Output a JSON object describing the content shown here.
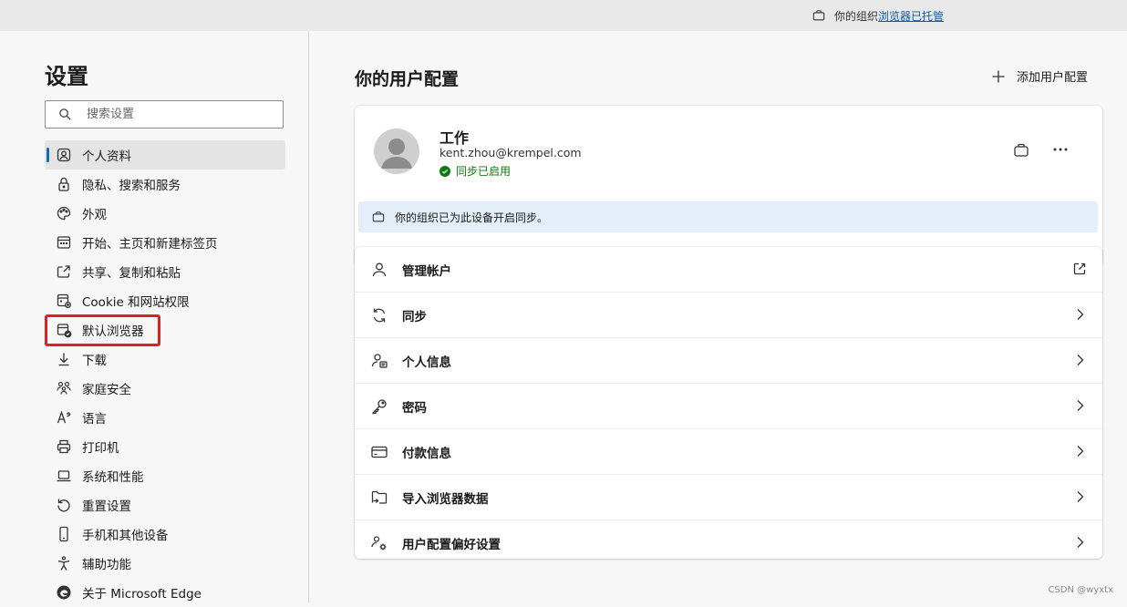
{
  "top_bar": {
    "managed_prefix": "你的组织",
    "managed_link": "浏览器已托管",
    "icon": "briefcase-icon"
  },
  "sidebar": {
    "title": "设置",
    "search_placeholder": "搜索设置",
    "items": [
      {
        "label": "个人资料",
        "icon": "profile-icon",
        "active": true
      },
      {
        "label": "隐私、搜索和服务",
        "icon": "lock-icon"
      },
      {
        "label": "外观",
        "icon": "palette-icon"
      },
      {
        "label": "开始、主页和新建标签页",
        "icon": "home-grid-icon"
      },
      {
        "label": "共享、复制和粘贴",
        "icon": "share-icon"
      },
      {
        "label": "Cookie 和网站权限",
        "icon": "site-permissions-icon"
      },
      {
        "label": "默认浏览器",
        "icon": "default-browser-icon",
        "highlighted": true
      },
      {
        "label": "下载",
        "icon": "download-icon"
      },
      {
        "label": "家庭安全",
        "icon": "family-icon"
      },
      {
        "label": "语言",
        "icon": "language-icon"
      },
      {
        "label": "打印机",
        "icon": "printer-icon"
      },
      {
        "label": "系统和性能",
        "icon": "laptop-icon"
      },
      {
        "label": "重置设置",
        "icon": "reset-icon"
      },
      {
        "label": "手机和其他设备",
        "icon": "phone-icon"
      },
      {
        "label": "辅助功能",
        "icon": "accessibility-icon"
      },
      {
        "label": "关于 Microsoft Edge",
        "icon": "edge-logo-icon"
      }
    ]
  },
  "main": {
    "title": "你的用户配置",
    "add_profile_label": "添加用户配置",
    "profile": {
      "name": "工作",
      "email": "kent.zhou@krempel.com",
      "sync_status": "同步已启用",
      "sync_notice": "你的组织已为此设备开启同步。"
    },
    "rows": [
      {
        "label": "管理帐户",
        "icon": "person-icon",
        "trail": "external-link-icon"
      },
      {
        "label": "同步",
        "icon": "sync-icon",
        "trail": "chevron-right-icon"
      },
      {
        "label": "个人信息",
        "icon": "personal-info-icon",
        "trail": "chevron-right-icon"
      },
      {
        "label": "密码",
        "icon": "key-icon",
        "trail": "chevron-right-icon"
      },
      {
        "label": "付款信息",
        "icon": "card-icon",
        "trail": "chevron-right-icon"
      },
      {
        "label": "导入浏览器数据",
        "icon": "import-icon",
        "trail": "chevron-right-icon"
      },
      {
        "label": "用户配置偏好设置",
        "icon": "profile-settings-icon",
        "trail": "chevron-right-icon"
      }
    ]
  },
  "watermark": "CSDN @wyxtx",
  "colors": {
    "accent": "#0f6cbd",
    "highlight_border": "#e0201a",
    "sync_green": "#0e7a0d"
  }
}
